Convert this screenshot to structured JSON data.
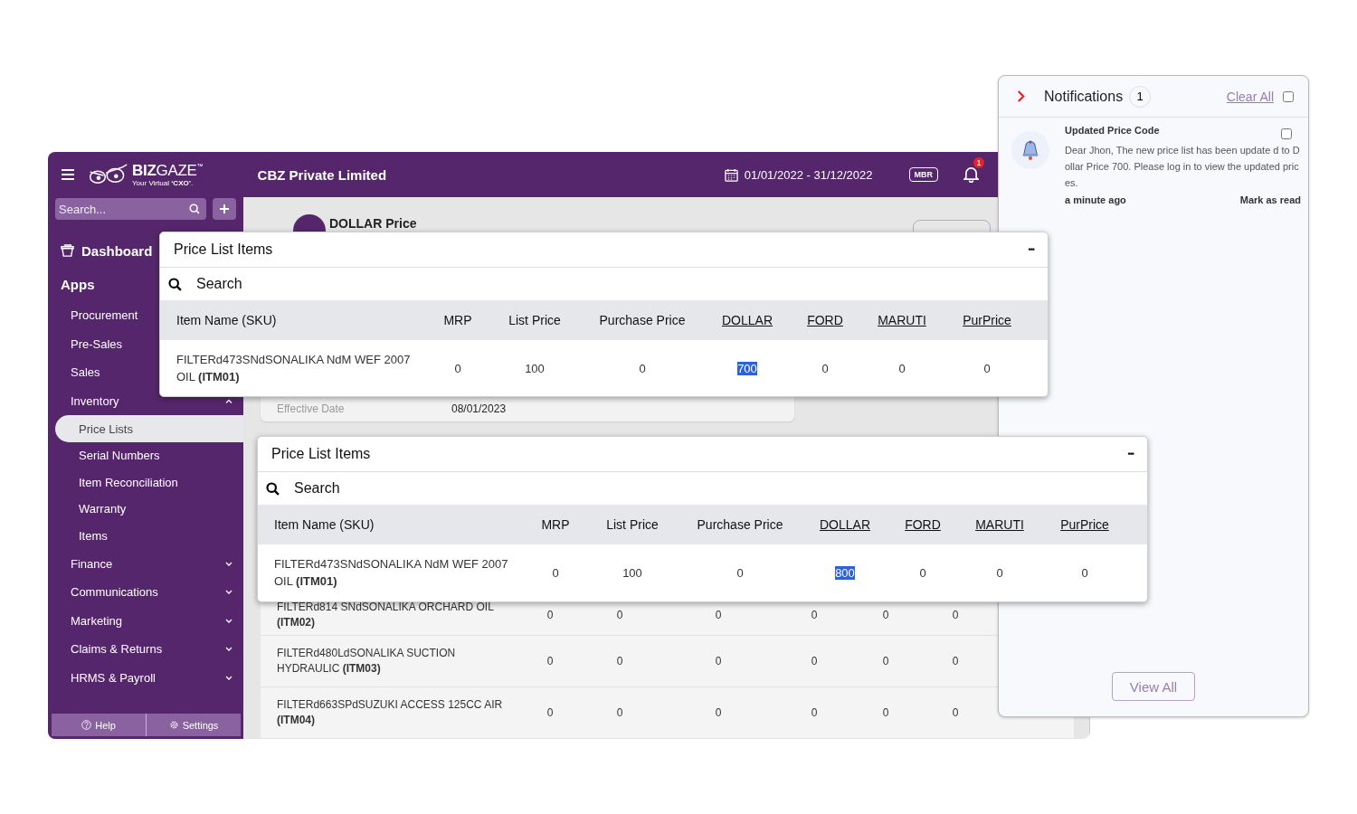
{
  "header": {
    "logo": "**BIZ**GAZE",
    "logo_mark": "™",
    "tagline": "Your Virtual **‘CXO’**.",
    "company": "CBZ Private Limited",
    "date_range": "01/01/2022 - 31/12/2022",
    "badge": "MBR",
    "notification_count": "1"
  },
  "sidebar": {
    "search": {
      "placeholder": "Search..."
    },
    "dashboard": "Dashboard",
    "section": "Apps",
    "items": [
      {
        "label": "Procurement"
      },
      {
        "label": "Pre-Sales"
      },
      {
        "label": "Sales"
      },
      {
        "label": "Inventory",
        "expanded": true,
        "children": [
          {
            "label": "Price Lists",
            "selected": true
          },
          {
            "label": "Serial Numbers",
            "selected": false
          },
          {
            "label": "Item Reconciliation",
            "selected": false
          },
          {
            "label": "Warranty",
            "selected": false
          },
          {
            "label": "Items",
            "selected": false
          }
        ]
      },
      {
        "label": "Finance",
        "expanded": false
      },
      {
        "label": "Communications",
        "expanded": false
      },
      {
        "label": "Marketing",
        "expanded": false
      },
      {
        "label": "Claims & Returns",
        "expanded": false
      },
      {
        "label": "HRMS & Payroll",
        "expanded": false
      }
    ],
    "footer": [
      {
        "kind": "help",
        "label": "Help"
      },
      {
        "kind": "settings",
        "label": "Settings"
      }
    ]
  },
  "page": {
    "title": "DOLLAR Price",
    "effective_date": {
      "label": "Effective Date",
      "value": "08/01/2023"
    },
    "rows": [
      {
        "name": "FILTERd814 SNdSONALIKA ORCHARD OIL **(ITM02)**",
        "values": [
          "0",
          "0",
          "0",
          "0",
          "0",
          "0"
        ]
      },
      {
        "name": "FILTERd480LdSONALIKA SUCTION HYDRAULIC **(ITM03)**",
        "values": [
          "0",
          "0",
          "0",
          "0",
          "0",
          "0"
        ]
      },
      {
        "name": "FILTERd663SPdSUZUKI ACCESS 125CC AIR **(ITM04)**",
        "values": [
          "0",
          "0",
          "0",
          "0",
          "0",
          "0"
        ]
      }
    ]
  },
  "popups": [
    {
      "title": "Price List Items",
      "menu": "•••",
      "search": {
        "placeholder": "Search"
      },
      "columns": [
        {
          "label": "Item Name (SKU)",
          "linked": false
        },
        {
          "label": "MRP",
          "linked": false
        },
        {
          "label": "List Price",
          "linked": false
        },
        {
          "label": "Purchase Price",
          "linked": false
        },
        {
          "label": "DOLLAR",
          "linked": true
        },
        {
          "label": "FORD",
          "linked": true
        },
        {
          "label": "MARUTI",
          "linked": true
        },
        {
          "label": "PurPrice",
          "linked": true
        }
      ],
      "row": {
        "name": "FILTERd473SNdSONALIKA NdM WEF 2007 OIL **(ITM01)**",
        "cells": [
          {
            "text": "0",
            "selected": false
          },
          {
            "text": "100",
            "selected": false
          },
          {
            "text": "0",
            "selected": false
          },
          {
            "text": "700",
            "selected": true
          },
          {
            "text": "0",
            "selected": false
          },
          {
            "text": "0",
            "selected": false
          },
          {
            "text": "0",
            "selected": false
          }
        ]
      }
    },
    {
      "title": "Price List Items",
      "menu": "•••",
      "search": {
        "placeholder": "Search"
      },
      "columns": [
        {
          "label": "Item Name (SKU)",
          "linked": false
        },
        {
          "label": "MRP",
          "linked": false
        },
        {
          "label": "List Price",
          "linked": false
        },
        {
          "label": "Purchase Price",
          "linked": false
        },
        {
          "label": "DOLLAR",
          "linked": true
        },
        {
          "label": "FORD",
          "linked": true
        },
        {
          "label": "MARUTI",
          "linked": true
        },
        {
          "label": "PurPrice",
          "linked": true
        }
      ],
      "row": {
        "name": "FILTERd473SNdSONALIKA NdM WEF 2007 OIL **(ITM01)**",
        "cells": [
          {
            "text": "0",
            "selected": false
          },
          {
            "text": "100",
            "selected": false
          },
          {
            "text": "0",
            "selected": false
          },
          {
            "text": "800",
            "selected": true
          },
          {
            "text": "0",
            "selected": false
          },
          {
            "text": "0",
            "selected": false
          },
          {
            "text": "0",
            "selected": false
          }
        ]
      }
    }
  ],
  "notifications": {
    "title": "Notifications",
    "count": "1",
    "clear_all": "Clear All",
    "all_checked": false,
    "items": [
      {
        "title": "Updated Price Code",
        "body": "Dear Jhon, The new price list has been update d to Dollar Price 700. Please log in to view the updated prices.",
        "time": "a minute ago",
        "action": "Mark as read",
        "checked": false
      }
    ],
    "view_all": "View All"
  }
}
